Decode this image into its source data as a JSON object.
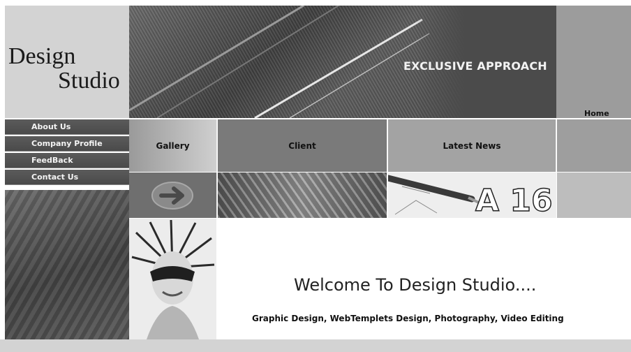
{
  "header": {
    "logo_line1": "Design",
    "logo_line2": "Studio",
    "tagline": "EXCLUSIVE APPROACH",
    "home_label": "Home"
  },
  "side_nav": {
    "items": [
      {
        "label": "About Us"
      },
      {
        "label": "Company Profile"
      },
      {
        "label": "FeedBack"
      },
      {
        "label": "Contact Us"
      }
    ]
  },
  "menu": {
    "items": [
      {
        "label": "Gallery"
      },
      {
        "label": "Client"
      },
      {
        "label": "Latest News"
      }
    ]
  },
  "content": {
    "welcome": "Welcome To Design Studio....",
    "services": "Graphic Design, WebTemplets Design, Photography, Video Editing"
  },
  "thumbnails": {
    "drafting_text": "A 16"
  },
  "colors": {
    "panel_gray": "#d3d3d3",
    "banner_dark": "#4b4b4b",
    "nav_bg": "#4a4a4a"
  }
}
